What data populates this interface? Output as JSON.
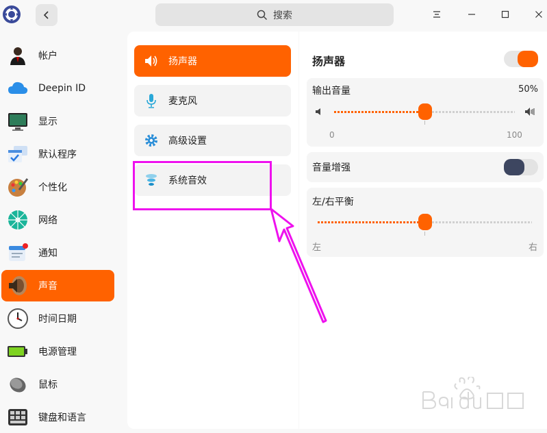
{
  "titlebar": {
    "search_placeholder": "搜索",
    "menu_icon": "menu-icon",
    "min_icon": "minimize-icon",
    "max_icon": "maximize-icon",
    "close_icon": "close-icon"
  },
  "sidebar": {
    "items": [
      {
        "label": "帐户",
        "icon": "account-icon",
        "active": false
      },
      {
        "label": "Deepin ID",
        "icon": "cloud-icon",
        "active": false
      },
      {
        "label": "显示",
        "icon": "display-icon",
        "active": false
      },
      {
        "label": "默认程序",
        "icon": "default-apps-icon",
        "active": false
      },
      {
        "label": "个性化",
        "icon": "personalization-icon",
        "active": false
      },
      {
        "label": "网络",
        "icon": "network-icon",
        "active": false
      },
      {
        "label": "通知",
        "icon": "notification-icon",
        "active": false
      },
      {
        "label": "声音",
        "icon": "sound-icon",
        "active": true
      },
      {
        "label": "时间日期",
        "icon": "clock-icon",
        "active": false
      },
      {
        "label": "电源管理",
        "icon": "battery-icon",
        "active": false
      },
      {
        "label": "鼠标",
        "icon": "mouse-icon",
        "active": false
      },
      {
        "label": "键盘和语言",
        "icon": "keyboard-icon",
        "active": false
      }
    ]
  },
  "middle": {
    "items": [
      {
        "label": "扬声器",
        "icon": "speaker-icon",
        "active": true
      },
      {
        "label": "麦克风",
        "icon": "microphone-icon",
        "active": false
      },
      {
        "label": "高级设置",
        "icon": "gear-icon",
        "active": false
      },
      {
        "label": "系统音效",
        "icon": "sound-effects-icon",
        "active": false
      }
    ]
  },
  "right": {
    "title": "扬声器",
    "speaker_enabled": true,
    "output_volume": {
      "label": "输出音量",
      "value_text": "50%",
      "value": 50,
      "min_label": "0",
      "max_label": "100"
    },
    "volume_boost": {
      "label": "音量增强",
      "enabled": false
    },
    "balance": {
      "label": "左/右平衡",
      "value": 0.5,
      "left_label": "左",
      "right_label": "右"
    }
  },
  "colors": {
    "accent": "#ff6200",
    "highlight": "#ee11ee"
  }
}
